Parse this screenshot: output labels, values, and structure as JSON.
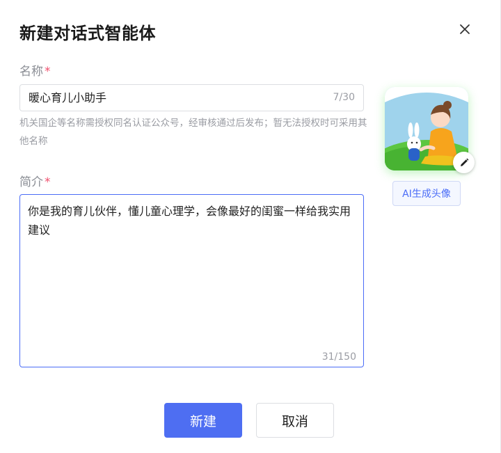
{
  "dialog": {
    "title": "新建对话式智能体",
    "close_icon": "close-icon"
  },
  "name_field": {
    "label": "名称",
    "required_mark": "*",
    "value": "暖心育儿小助手",
    "count": "7/30",
    "hint": "机关国企等名称需授权同名认证公众号，经审核通过后发布；暂无法授权时可采用其他名称"
  },
  "desc_field": {
    "label": "简介",
    "required_mark": "*",
    "value": "你是我的育儿伙伴，懂儿童心理学，会像最好的闺蜜一样给我实用建议",
    "count": "31/150"
  },
  "avatar": {
    "edit_icon": "pencil-icon",
    "ai_button_label": "AI生成头像",
    "accent_color": "#4a6cf7"
  },
  "footer": {
    "create_label": "新建",
    "cancel_label": "取消",
    "primary_color": "#4e6ef2"
  }
}
